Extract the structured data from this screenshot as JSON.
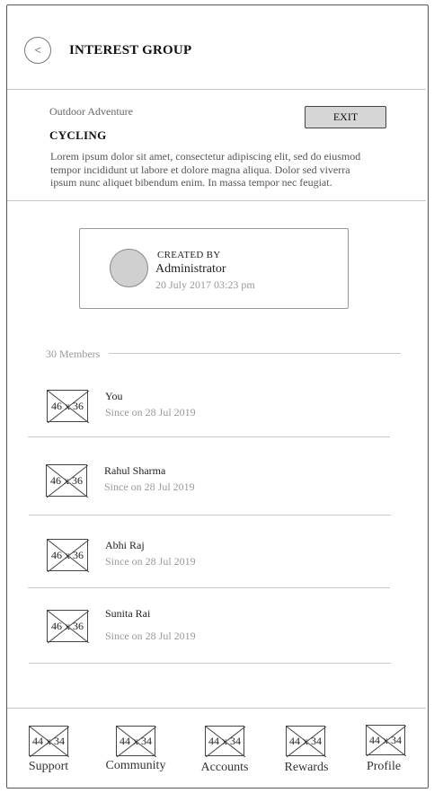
{
  "header": {
    "back_label": "<",
    "title": "INTEREST GROUP"
  },
  "group": {
    "category": "Outdoor Adventure",
    "name": "CYCLING",
    "exit_label": "EXIT",
    "description": "Lorem ipsum dolor sit amet, consectetur adipiscing elit, sed do eiusmod tempor incididunt ut labore et dolore magna aliqua. Dolor sed viverra ipsum nunc aliquet bibendum enim. In massa tempor nec feugiat."
  },
  "creator": {
    "label": "CREATED BY",
    "name": "Administrator",
    "date": "20 July 2017 03:23 pm"
  },
  "members": {
    "count_label": "30 Members",
    "items": [
      {
        "avatar": "46 x 36",
        "name": "You",
        "since": "Since on 28 Jul 2019"
      },
      {
        "avatar": "46 x 36",
        "name": "Rahul Sharma",
        "since": "Since on 28 Jul 2019"
      },
      {
        "avatar": "46 x 36",
        "name": "Abhi Raj",
        "since": "Since on 28 Jul 2019"
      },
      {
        "avatar": "46 x 36",
        "name": "Sunita Rai",
        "since": "Since on 28 Jul 2019"
      }
    ]
  },
  "nav": {
    "items": [
      {
        "icon": "44 x 34",
        "label": "Support"
      },
      {
        "icon": "44 x 34",
        "label": "Community"
      },
      {
        "icon": "44 x 34",
        "label": "Accounts"
      },
      {
        "icon": "44 x 34",
        "label": "Rewards"
      },
      {
        "icon": "44 x 34",
        "label": "Profile"
      }
    ]
  }
}
